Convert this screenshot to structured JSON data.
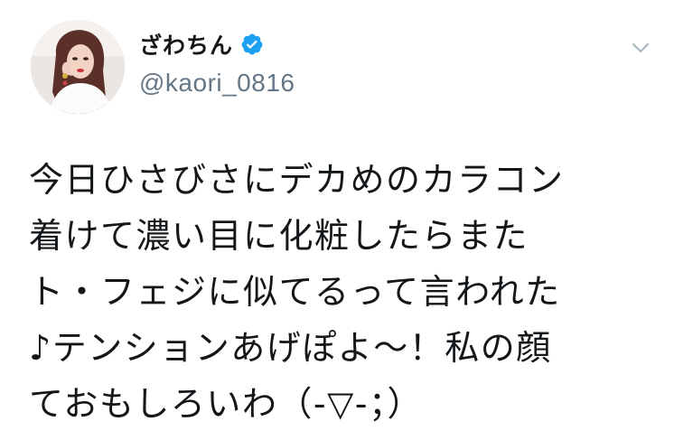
{
  "user": {
    "display_name": "ざわちん",
    "handle": "@kaori_0816",
    "verified": true,
    "verified_color": "#1da1f2"
  },
  "icons": {
    "avatar": "profile-photo",
    "verified": "verified-badge-icon",
    "menu": "chevron-down-icon"
  },
  "tweet": {
    "lines": [
      "今日ひさびさにデカめのカラコン",
      "着けて濃い目に化粧したらまた",
      "ト・フェジに似てるって言われた",
      "♪テンションあげぽよ〜！私の顔",
      "ておもしろいわ（-▽-；）"
    ]
  },
  "colors": {
    "text": "#14171a",
    "secondary": "#657786",
    "background": "#ffffff"
  }
}
